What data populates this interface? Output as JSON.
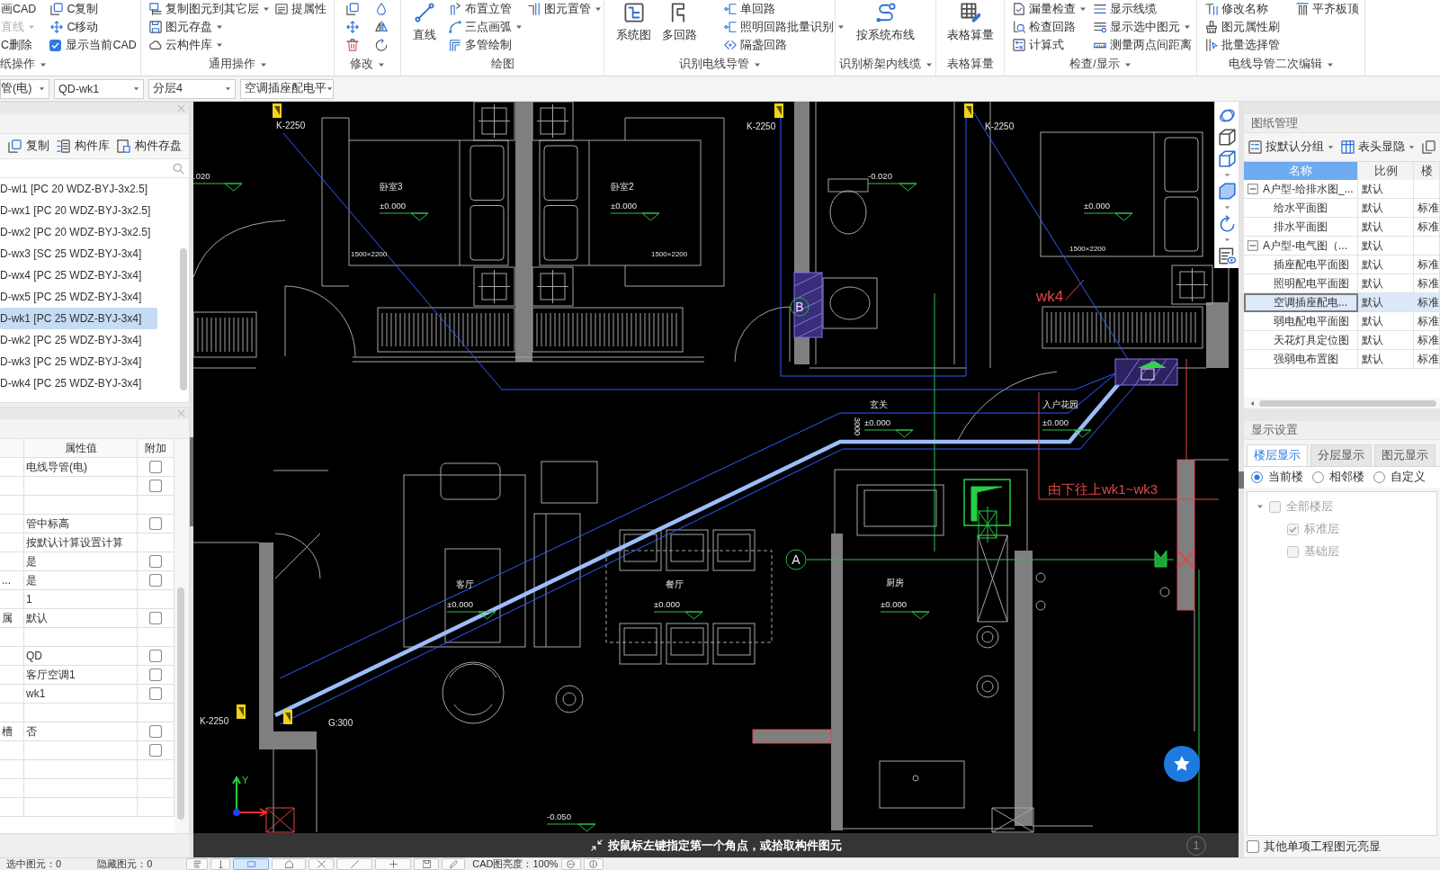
{
  "ribbon": {
    "groups": [
      {
        "label": "纸操作",
        "has_menu": true,
        "columns": [
          [
            {
              "kind": "small",
              "label": "画CAD",
              "has_menu": false,
              "disabled": false
            },
            {
              "kind": "small",
              "label": "直线",
              "has_menu": true,
              "disabled": true
            },
            {
              "kind": "small",
              "label": "C删除",
              "has_menu": false,
              "disabled": false
            }
          ],
          [
            {
              "kind": "small",
              "label": "C复制",
              "has_menu": false,
              "disabled": false
            },
            {
              "kind": "small",
              "label": "C移动",
              "has_menu": false,
              "disabled": false
            },
            {
              "kind": "check",
              "label": "显示当前CAD",
              "checked": true,
              "disabled": false
            }
          ]
        ]
      },
      {
        "label": "通用操作",
        "has_menu": true,
        "columns": [
          [
            {
              "kind": "small",
              "label": "复制图元到其它层",
              "has_menu": true,
              "disabled": false
            },
            {
              "kind": "small",
              "label": "图元存盘",
              "has_menu": true,
              "disabled": false
            },
            {
              "kind": "small",
              "label": "云构件库",
              "has_menu": true,
              "disabled": false
            }
          ],
          [
            {
              "kind": "small",
              "label": "提属性",
              "has_menu": false,
              "disabled": false
            }
          ]
        ]
      },
      {
        "label": "修改",
        "has_menu": true,
        "columns": [
          [
            {
              "kind": "icon",
              "disabled": false
            },
            {
              "kind": "icon",
              "disabled": false
            },
            {
              "kind": "icon",
              "disabled": false
            }
          ],
          [
            {
              "kind": "icon",
              "disabled": false
            },
            {
              "kind": "icon",
              "disabled": false
            },
            {
              "kind": "icon",
              "disabled": false
            }
          ]
        ]
      },
      {
        "label": "绘图",
        "has_menu": false,
        "columns": [
          [
            {
              "kind": "large",
              "label": "直线",
              "has_menu": false,
              "disabled": false
            }
          ],
          [
            {
              "kind": "small",
              "label": "布置立管",
              "has_menu": false,
              "disabled": false
            },
            {
              "kind": "small",
              "label": "三点画弧",
              "has_menu": true,
              "disabled": false
            },
            {
              "kind": "small",
              "label": "多管绘制",
              "has_menu": false,
              "disabled": false
            }
          ],
          [
            {
              "kind": "small",
              "label": "图元置管",
              "has_menu": true,
              "disabled": false
            }
          ]
        ]
      },
      {
        "label": "识别电线导管",
        "has_menu": true,
        "columns": [
          [
            {
              "kind": "large",
              "label": "系统图",
              "has_menu": false,
              "disabled": false
            }
          ],
          [
            {
              "kind": "large",
              "label": "多回路",
              "has_menu": false,
              "disabled": false
            }
          ],
          [
            {
              "kind": "small",
              "label": "单回路",
              "has_menu": false,
              "disabled": false
            },
            {
              "kind": "small",
              "label": "照明回路批量识别",
              "has_menu": true,
              "disabled": false
            },
            {
              "kind": "small",
              "label": "隔盏回路",
              "has_menu": false,
              "disabled": false
            }
          ]
        ]
      },
      {
        "label": "识别桥架内线缆",
        "has_menu": true,
        "columns": [
          [
            {
              "kind": "large",
              "label": "按系统布线",
              "has_menu": false,
              "disabled": false
            }
          ]
        ]
      },
      {
        "label": "表格算量",
        "has_menu": false,
        "columns": [
          [
            {
              "kind": "large",
              "label": "表格算量",
              "has_menu": false,
              "disabled": false
            }
          ]
        ]
      },
      {
        "label": "检查/显示",
        "has_menu": true,
        "columns": [
          [
            {
              "kind": "small",
              "label": "漏量检查",
              "has_menu": true,
              "disabled": false
            },
            {
              "kind": "small",
              "label": "检查回路",
              "has_menu": false,
              "disabled": false
            },
            {
              "kind": "small",
              "label": "计算式",
              "has_menu": false,
              "disabled": false
            }
          ],
          [
            {
              "kind": "small",
              "label": "显示线缆",
              "has_menu": false,
              "disabled": false
            },
            {
              "kind": "small",
              "label": "显示选中图元",
              "has_menu": true,
              "disabled": false
            },
            {
              "kind": "small",
              "label": "测量两点间距离",
              "has_menu": false,
              "disabled": false
            }
          ]
        ]
      },
      {
        "label": "电线导管二次编辑",
        "has_menu": true,
        "columns": [
          [
            {
              "kind": "small",
              "label": "修改名称",
              "has_menu": false,
              "disabled": false
            },
            {
              "kind": "small",
              "label": "图元属性刷",
              "has_menu": false,
              "disabled": false
            },
            {
              "kind": "small",
              "label": "批量选择管",
              "has_menu": false,
              "disabled": false
            }
          ],
          [
            {
              "kind": "small",
              "label": "平齐板顶",
              "has_menu": false,
              "disabled": false
            }
          ]
        ]
      }
    ]
  },
  "toolbar": {
    "dropdowns": [
      {
        "value": "管(电)"
      },
      {
        "value": "QD-wk1"
      },
      {
        "value": "分层4"
      },
      {
        "value": "空调插座配电平"
      }
    ]
  },
  "component_panel": {
    "toolbar": [
      {
        "label": "复制"
      },
      {
        "label": "构件库"
      },
      {
        "label": "构件存盘"
      }
    ],
    "items": [
      {
        "label": "D-wl1 [PC 20 WDZ-BYJ-3x2.5]",
        "selected": false
      },
      {
        "label": "D-wx1 [PC 20 WDZ-BYJ-3x2.5]",
        "selected": false
      },
      {
        "label": "D-wx2 [PC 20 WDZ-BYJ-3x2.5]",
        "selected": false
      },
      {
        "label": "D-wx3 [SC 25 WDZ-BYJ-3x4]",
        "selected": false
      },
      {
        "label": "D-wx4 [PC 25 WDZ-BYJ-3x4]",
        "selected": false
      },
      {
        "label": "D-wx5 [PC 25 WDZ-BYJ-3x4]",
        "selected": false
      },
      {
        "label": "D-wk1 [PC 25 WDZ-BYJ-3x4]",
        "selected": true
      },
      {
        "label": "D-wk2 [PC 25 WDZ-BYJ-3x4]",
        "selected": false
      },
      {
        "label": "D-wk3 [PC 25 WDZ-BYJ-3x4]",
        "selected": false
      },
      {
        "label": "D-wk4 [PC 25 WDZ-BYJ-3x4]",
        "selected": false
      }
    ]
  },
  "property_panel": {
    "columns": [
      "属性值",
      "附加"
    ],
    "rows": [
      {
        "kind": "check",
        "value": "电线导管(电)",
        "checked": false
      },
      {
        "kind": "check",
        "checked": false
      },
      {
        "kind": "plain"
      },
      {
        "kind": "check",
        "value": "管中标高",
        "checked": false
      },
      {
        "kind": "plain",
        "value": "按默认计算设置计算"
      },
      {
        "kind": "check",
        "value": "是",
        "checked": false
      },
      {
        "kind": "check",
        "name": "...",
        "value": "是",
        "checked": false
      },
      {
        "kind": "plain",
        "value": "1"
      },
      {
        "kind": "check",
        "name": "属",
        "value": "默认",
        "checked": false
      },
      {
        "kind": "plain"
      },
      {
        "kind": "check",
        "value": "QD",
        "checked": false
      },
      {
        "kind": "check",
        "value": "客厅空调1",
        "checked": false
      },
      {
        "kind": "check",
        "value": "wk1",
        "checked": false
      },
      {
        "kind": "plain"
      },
      {
        "kind": "check",
        "name": "槽",
        "value": "否",
        "checked": false
      },
      {
        "kind": "check",
        "checked": false
      },
      {
        "kind": "plain"
      },
      {
        "kind": "plain"
      },
      {
        "kind": "plain"
      }
    ]
  },
  "canvas": {
    "labels": [
      "K-2250",
      "K-2250",
      "K-2250",
      ".020",
      "-0.020",
      "±0.000",
      "±0.000",
      "±0.000",
      "1500×2200",
      "1500×2200",
      "1500×2200",
      "±0.000",
      "±0.000",
      "3000",
      "±0.000",
      "±0.000",
      "±0.000",
      "K-2250",
      "G:300",
      "-0.050"
    ],
    "room_labels": [
      "卧室3",
      "卧室2",
      "客厅",
      "餐厅",
      "玄关",
      "入户花园",
      "厨房"
    ],
    "annotations": [
      "wk4",
      "由下往上wk1~wk3"
    ],
    "markers": [
      "B",
      "A"
    ],
    "axis_label": "Y",
    "hint": "按鼠标左键指定第一个角点，或拾取构件图元",
    "grid_marker": "1"
  },
  "drawing_panel": {
    "title": "图纸管理",
    "toolbar": [
      {
        "label": "按默认分组",
        "has_menu": true
      },
      {
        "label": "表头显隐",
        "has_menu": true
      },
      {
        "has_menu": false
      }
    ],
    "columns": [
      "名称",
      "比例",
      "楼"
    ],
    "rows": [
      {
        "name": "A户型-给排水图_...",
        "scale": "默认",
        "expanded": true,
        "selected": false,
        "children": [
          {
            "name": "给水平面图",
            "scale": "默认",
            "floor": "标准",
            "selected": false
          },
          {
            "name": "排水平面图",
            "scale": "默认",
            "floor": "标准",
            "selected": false
          }
        ]
      },
      {
        "name": "A户型-电气图（...",
        "scale": "默认",
        "expanded": true,
        "selected": false,
        "children": [
          {
            "name": "插座配电平面图",
            "scale": "默认",
            "floor": "标准",
            "selected": false
          },
          {
            "name": "照明配电平面图",
            "scale": "默认",
            "floor": "标准",
            "selected": false
          },
          {
            "name": "空调插座配电...",
            "scale": "默认",
            "floor": "标准",
            "selected": true
          },
          {
            "name": "弱电配电平面图",
            "scale": "默认",
            "floor": "标准",
            "selected": false
          },
          {
            "name": "天花灯具定位图",
            "scale": "默认",
            "floor": "标准",
            "selected": false
          },
          {
            "name": "强弱电布置图",
            "scale": "默认",
            "floor": "标准",
            "selected": false
          }
        ]
      }
    ]
  },
  "display_settings": {
    "title": "显示设置",
    "tabs": [
      {
        "label": "楼层显示",
        "selected": true
      },
      {
        "label": "分层显示",
        "selected": false
      },
      {
        "label": "图元显示",
        "selected": false
      }
    ],
    "options": [
      {
        "label": "当前楼",
        "selected": true
      },
      {
        "label": "相邻楼",
        "selected": false
      },
      {
        "label": "自定义",
        "selected": false
      }
    ],
    "floors": [
      {
        "label": "全部楼层",
        "checked": false,
        "disabled": true,
        "expanded": true,
        "children": [
          {
            "label": "标准层",
            "checked": true,
            "disabled": true
          },
          {
            "label": "基础层",
            "checked": false,
            "disabled": true
          }
        ]
      }
    ],
    "highlight_other": {
      "label": "其他单项工程图元亮显",
      "checked": false
    }
  },
  "status_bar": {
    "selected": "选中图元：0",
    "hidden": "隐藏图元：0",
    "tools": [
      {
        "selected": false
      },
      {
        "selected": false
      },
      {
        "selected": true
      },
      {
        "selected": false
      },
      {
        "selected": false
      },
      {
        "selected": false
      },
      {
        "selected": false
      },
      {
        "selected": false
      },
      {
        "selected": false
      }
    ],
    "brightness": "CAD图亮度：100%"
  }
}
